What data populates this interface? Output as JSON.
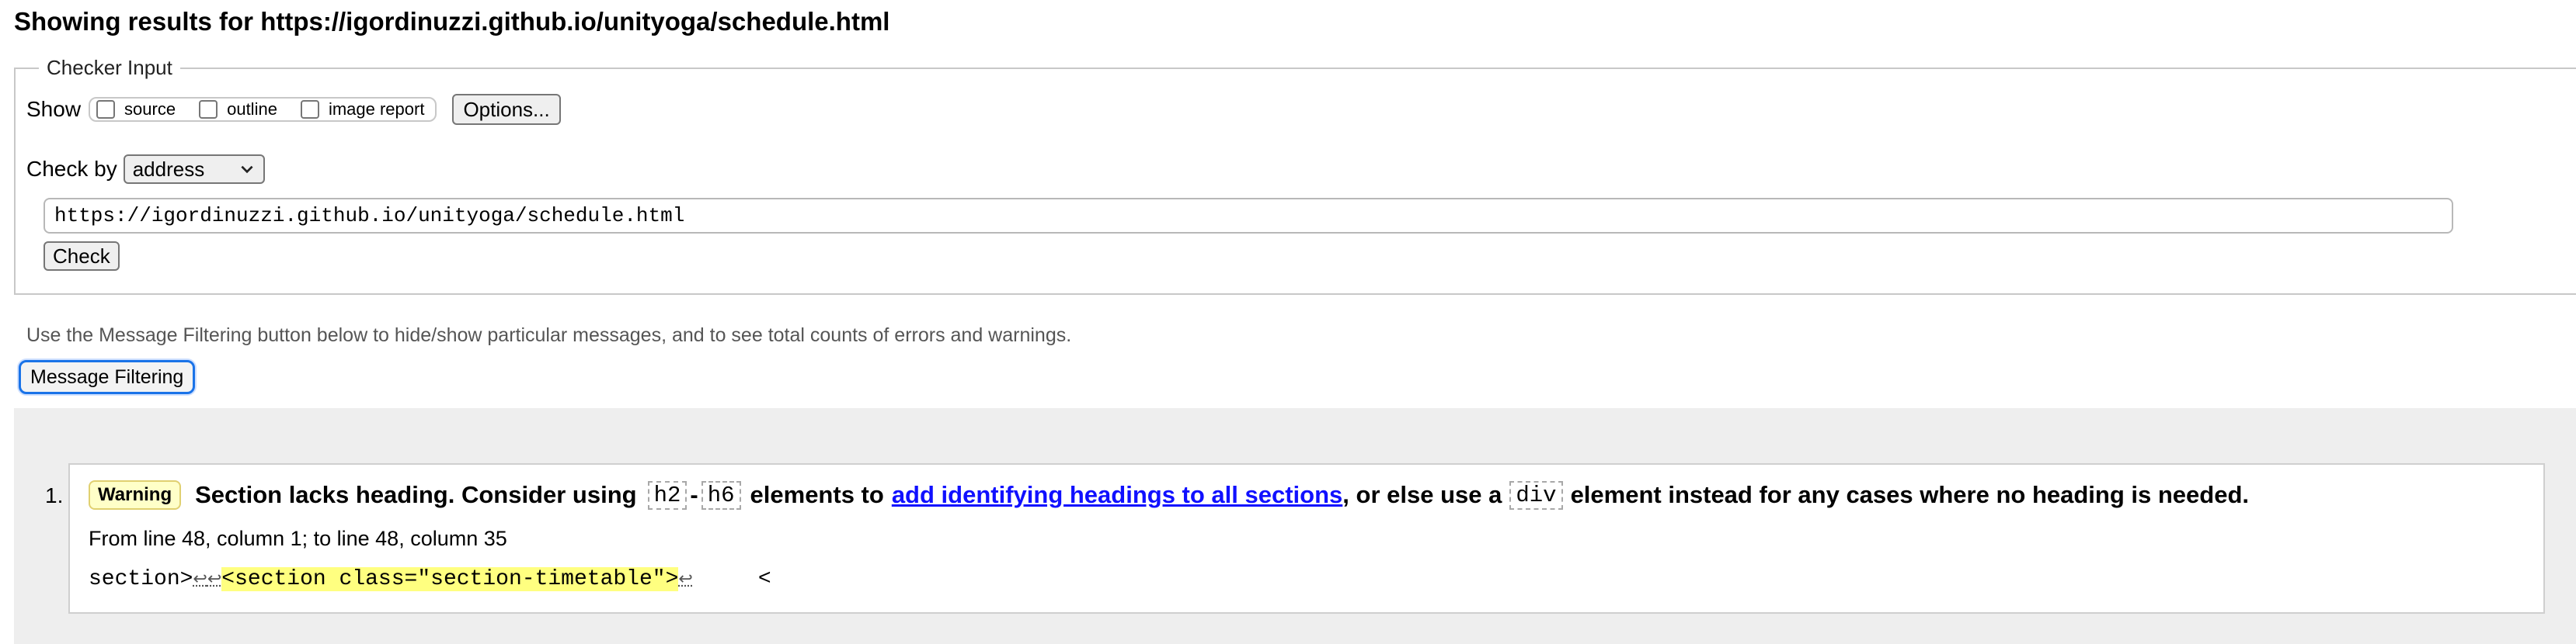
{
  "header": {
    "results_title": "Showing results for https://igordinuzzi.github.io/unityoga/schedule.html"
  },
  "checker": {
    "legend": "Checker Input",
    "show_label": "Show",
    "options": [
      {
        "label": "source",
        "checked": false
      },
      {
        "label": "outline",
        "checked": false
      },
      {
        "label": "image report",
        "checked": false
      }
    ],
    "options_button": "Options...",
    "check_by_label": "Check by",
    "check_by_value": "address",
    "url_value": "https://igordinuzzi.github.io/unityoga/schedule.html",
    "check_button": "Check"
  },
  "filter": {
    "hint": "Use the Message Filtering button below to hide/show particular messages, and to see total counts of errors and warnings.",
    "button": "Message Filtering"
  },
  "messages": [
    {
      "number": "1.",
      "type": "Warning",
      "text_before": "Section lacks heading. Consider using",
      "code_a": "h2",
      "dash": "-",
      "code_b": "h6",
      "text_mid": "elements to",
      "link": "add identifying headings to all sections",
      "text_after_link": ", or else use a",
      "code_c": "div",
      "text_end": "element instead for any cases where no heading is needed.",
      "location": "From line 48, column 1; to line 48, column 35",
      "extract_before": "section>",
      "extract_lf1": "↩",
      "extract_lf2": "↩",
      "extract_highlight": "<section class=\"section-timetable\">",
      "extract_lf3": "↩",
      "extract_after": "     <"
    }
  ],
  "colors": {
    "warning_badge_bg": "#ffffc8",
    "link": "#1010ff",
    "focus_ring": "#1a73e8",
    "highlight": "#ffff80"
  }
}
